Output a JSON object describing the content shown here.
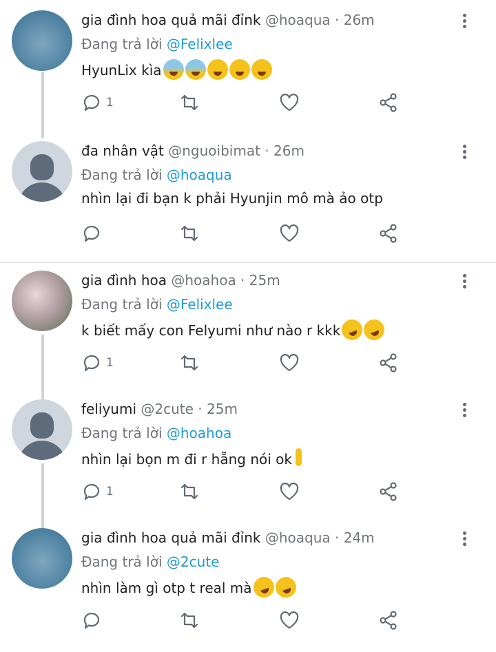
{
  "tweets": [
    {
      "name": "gia đình hoa quả mãi đỉnk",
      "handle": "@hoaqua · 26m",
      "reply_prefix": "Đang trả lời",
      "reply_to": "@Felixlee",
      "text": "HyunLix kìa",
      "emojis": [
        "fear",
        "fear",
        "love",
        "drool",
        "drool"
      ],
      "reply_count": "1",
      "avatar": "flowers"
    },
    {
      "name": "đa nhân vật",
      "handle": "@nguoibimat · 26m",
      "reply_prefix": "Đang trả lời",
      "reply_to": "@hoaqua",
      "text": "nhìn lại đi bạn k phải Hyunjin mô mà ảo otp",
      "emojis": [],
      "reply_count": "",
      "avatar": "default"
    },
    {
      "name": "gia đình hoa",
      "handle": "@hoahoa · 25m",
      "reply_prefix": "Đang trả lời",
      "reply_to": "@Felixlee",
      "text": "k biết mấy con Felyumi như nào r kkk",
      "emojis": [
        "rofl",
        "rofl"
      ],
      "reply_count": "1",
      "avatar": "tulips"
    },
    {
      "name": "feliyumi",
      "handle": "@2cute · 25m",
      "reply_prefix": "Đang trả lời",
      "reply_to": "@hoahoa",
      "text": "nhìn lại bọn m đi r hẵng nói ok",
      "emojis": [
        "hand"
      ],
      "reply_count": "1",
      "avatar": "default"
    },
    {
      "name": "gia đình hoa quả mãi đỉnk",
      "handle": "@hoaqua · 24m",
      "reply_prefix": "Đang trả lời",
      "reply_to": "@2cute",
      "text": "nhìn làm gì otp t real mà",
      "emojis": [
        "rofl",
        "rofl"
      ],
      "reply_count": "",
      "avatar": "flowers"
    }
  ],
  "icons": {
    "reply": "reply-icon",
    "retweet": "retweet-icon",
    "like": "like-icon",
    "share": "share-icon",
    "more": "more-icon"
  },
  "colors": {
    "link": "#1d9bd6",
    "muted": "#70757b",
    "icon": "#606a74"
  }
}
